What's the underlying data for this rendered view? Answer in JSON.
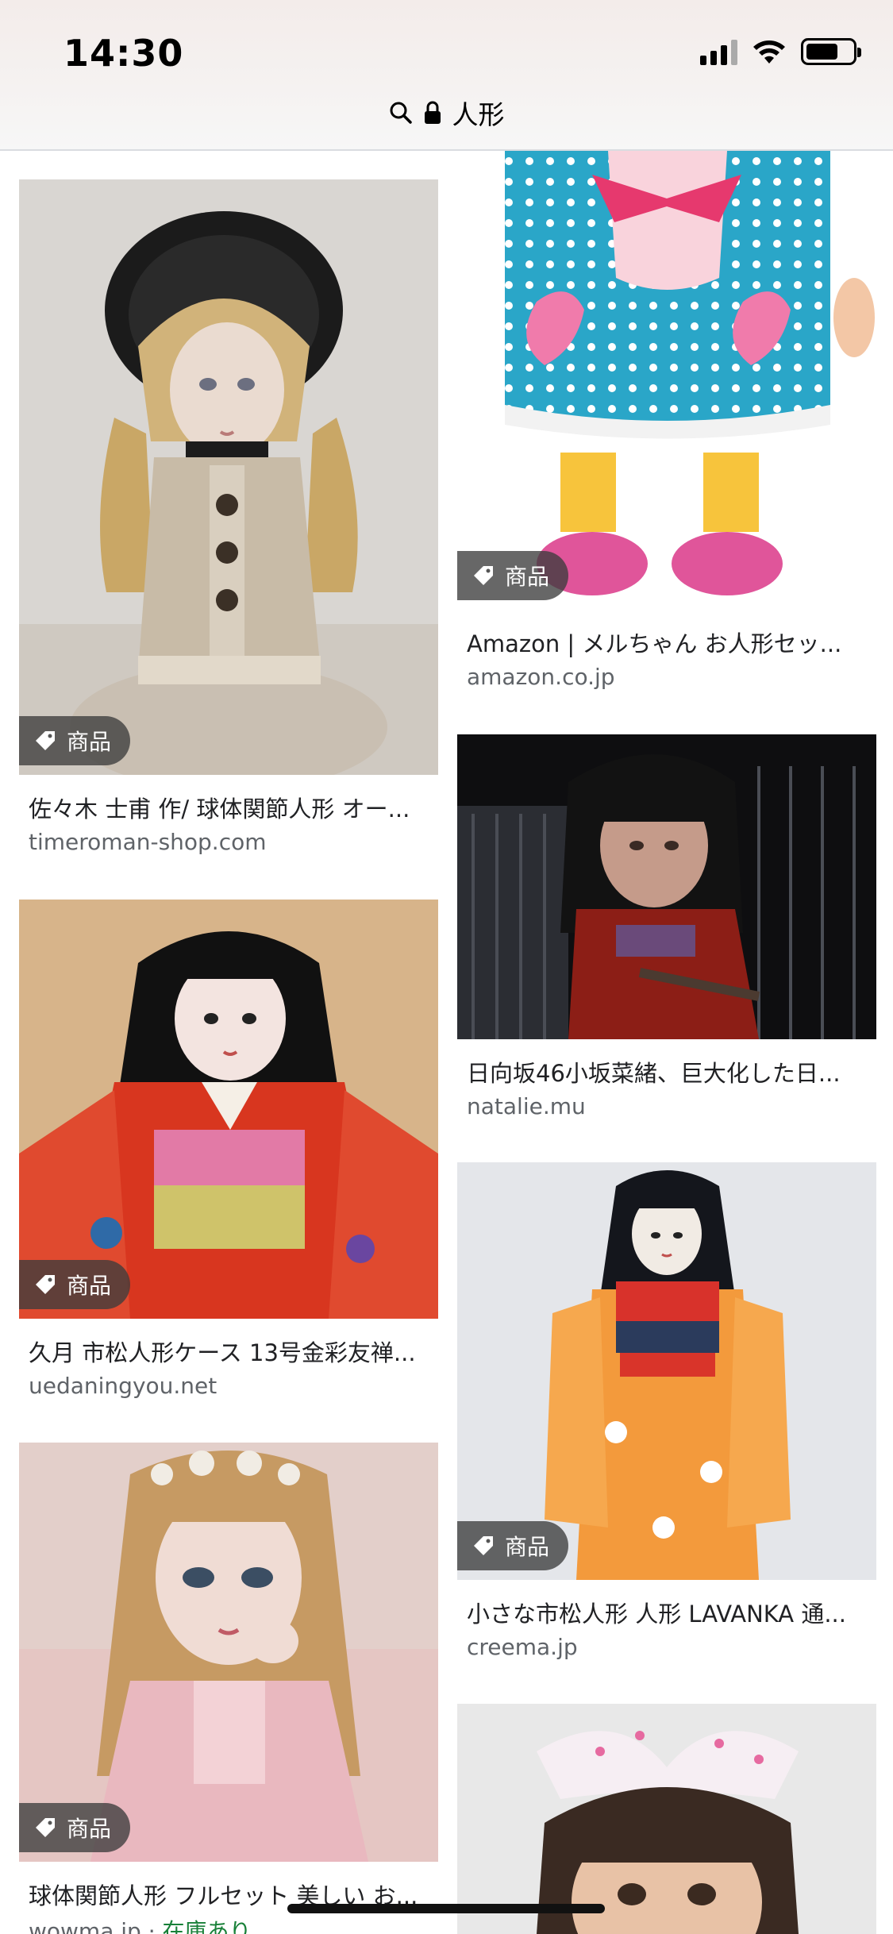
{
  "status_bar": {
    "time": "14:30"
  },
  "url_bar": {
    "query": "人形"
  },
  "results": [
    {
      "title": "佐々木 士甫 作/ 球体関節人形 オー...",
      "domain": "timeroman-shop.com",
      "badge": "商品"
    },
    {
      "title": "久月 市松人形ケース 13号金彩友禅...",
      "domain": "uedaningyou.net",
      "badge": "商品"
    },
    {
      "title": "球体関節人形 フルセット 美しい お...",
      "domain": "wowma.jp",
      "separator": " · ",
      "stock": "在庫あり",
      "badge": "商品"
    },
    {
      "title": "Amazon | メルちゃん お人形セッ...",
      "domain": "amazon.co.jp",
      "badge": "商品"
    },
    {
      "title": "日向坂46小坂菜緒、巨大化した日...",
      "domain": "natalie.mu"
    },
    {
      "title": "小さな市松人形 人形 LAVANKA 通...",
      "domain": "creema.jp",
      "badge": "商品"
    }
  ]
}
